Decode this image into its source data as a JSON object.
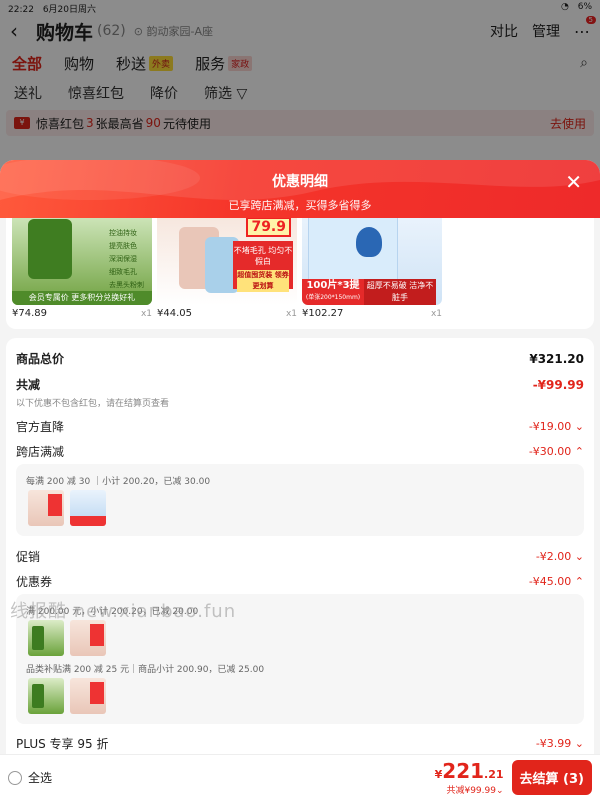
{
  "status": {
    "time": "22:22",
    "date": "6月20日周六",
    "battery": "6%"
  },
  "header": {
    "back_icon": "chevron-left-icon",
    "title": "购物车",
    "count": "(62)",
    "location": "韵动家园-A座",
    "compare": "对比",
    "manage": "管理",
    "more_badge": "5"
  },
  "tabs": [
    {
      "label": "全部",
      "tag": ""
    },
    {
      "label": "购物",
      "tag": ""
    },
    {
      "label": "秒送",
      "tag": "外卖"
    },
    {
      "label": "服务",
      "tag": "家政"
    }
  ],
  "filters": [
    "送礼",
    "惊喜红包",
    "降价",
    "筛选 ▽"
  ],
  "promo_banner": {
    "pre": "惊喜红包",
    "num1": "3",
    "mid": "张最高省",
    "num2": "90",
    "post": "元待使用",
    "action": "去使用"
  },
  "sheet": {
    "title": "优惠明细",
    "subtitle": "已享跨店满减，买得多省得多",
    "close_icon": "close-icon"
  },
  "products": [
    {
      "price": "¥74.89",
      "qty": "x1",
      "caption": "会员专属价 更多积分兑换好礼",
      "tags": [
        "控油持妆",
        "提亮肤色",
        "深润保湿",
        "细致毛孔",
        "去黑头粉刺"
      ]
    },
    {
      "price": "¥44.05",
      "qty": "x1",
      "price_tag": "79.9",
      "box_text": "不堵毛孔 均匀不假白",
      "box_badge": "超值囤货装 领券更划算"
    },
    {
      "price": "¥102.27",
      "qty": "x1",
      "deal_main": "100片*3提",
      "deal_sub": "(单张200*150mm)",
      "deal_right": "超厚不易破 洁净不脏手"
    }
  ],
  "summary": {
    "total_label": "商品总价",
    "total_value": "¥321.20",
    "discount_label": "共减",
    "discount_value": "-¥99.99",
    "discount_note": "以下优惠不包含红包，请在结算页查看",
    "official_label": "官方直降",
    "official_value": "-¥19.00 ⌄",
    "cross_label": "跨店满减",
    "cross_value": "-¥30.00 ⌃",
    "cross_detail": "每满 200 减 30 ｜小计 200.20，已减 30.00",
    "promo_label": "促销",
    "promo_value": "-¥2.00 ⌄",
    "coupon_label": "优惠券",
    "coupon_value": "-¥45.00 ⌃",
    "coupon_detail_1": "满 200.00 元，小计 200.20，已减 20.00",
    "coupon_detail_2": "品类补贴满 200 减 25 元｜商品小计 200.90，已减 25.00",
    "plus_label": "PLUS 专享 95 折",
    "plus_value": "-¥3.99 ⌄"
  },
  "watermark": "线报酷 new.xianbao.fun",
  "bottom": {
    "select_all": "全选",
    "yen": "¥",
    "price_int": "221",
    "price_dec": ".21",
    "discount": "共减¥99.99⌄",
    "checkout": "去结算 (3)"
  },
  "colors": {
    "accent": "#e1251b",
    "header_gradient_start": "#ff5a3c",
    "header_gradient_end": "#ee2a2a"
  }
}
